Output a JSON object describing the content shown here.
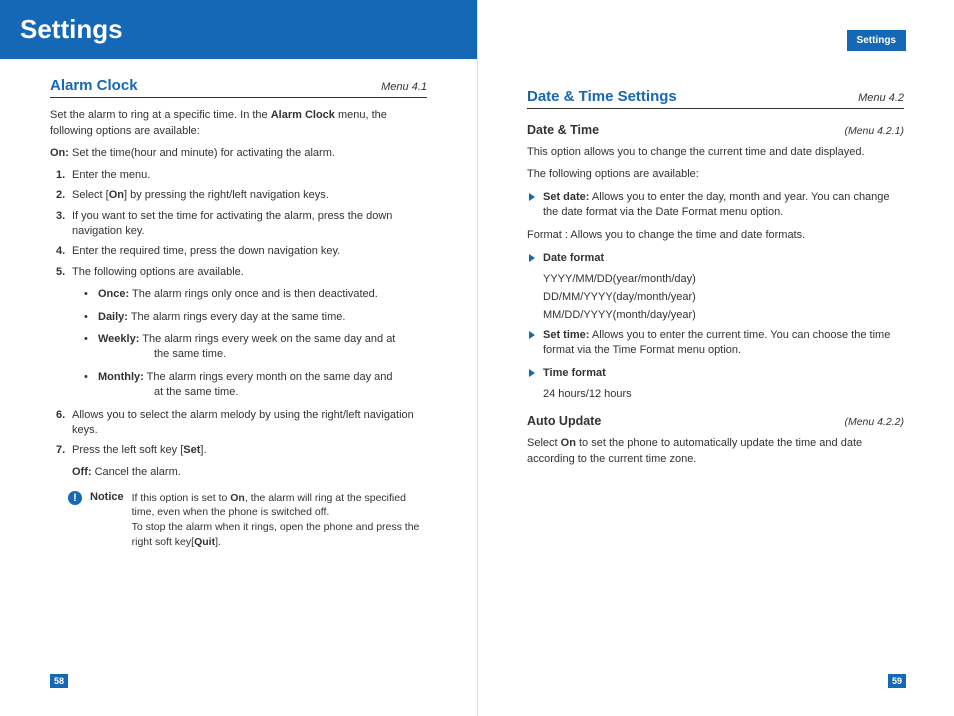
{
  "banner_title": "Settings",
  "header_tab": "Settings",
  "page_left_num": "58",
  "page_right_num": "59",
  "left": {
    "section_title": "Alarm Clock",
    "section_menu": "Menu 4.1",
    "intro_pre": "Set the alarm to ring at a specific time. In the ",
    "intro_bold": "Alarm Clock",
    "intro_post": " menu, the following options are available:",
    "on_label": "On:",
    "on_text": " Set the time(hour and minute) for activating the alarm.",
    "steps": {
      "s1": "Enter the menu.",
      "s2_pre": "Select [",
      "s2_bold": "On",
      "s2_post": "] by pressing the right/left navigation keys.",
      "s3": "If you want to set the time for activating the alarm, press the down navigation key.",
      "s4": "Enter the required time, press the down navigation key.",
      "s5": "The following options are available.",
      "once_l": "Once:",
      "once_t": " The alarm rings only once and is then deactivated.",
      "daily_l": "Daily:",
      "daily_t": " The alarm rings every day at the same time.",
      "weekly_l": "Weekly:",
      "weekly_t": " The alarm rings every week on the same day and at",
      "weekly_c": "the same time.",
      "monthly_l": "Monthly:",
      "monthly_t": " The alarm rings every month on the same day and",
      "monthly_c": "at the same time.",
      "s6": "Allows you to select the alarm melody by using the right/left navigation keys.",
      "s7_pre": "Press the left soft key [",
      "s7_bold": "Set",
      "s7_post": "]."
    },
    "off_label": "Off:",
    "off_text": " Cancel the alarm.",
    "notice_label": "Notice",
    "notice_a_pre": "If this option is set to ",
    "notice_a_bold": "On",
    "notice_a_post": ", the alarm will ring at the specified time, even when the phone is switched off.",
    "notice_b_pre": "To stop the alarm when it rings, open the phone and press the right soft key[",
    "notice_b_bold": "Quit",
    "notice_b_post": "]."
  },
  "right": {
    "section_title": "Date & Time Settings",
    "section_menu": "Menu 4.2",
    "dt_title": "Date & Time",
    "dt_menu": "(Menu 4.2.1)",
    "dt_intro": "This option allows you to change the current time and date displayed.",
    "dt_following": "The following options are available:",
    "setdate_l": "Set date:",
    "setdate_t": " Allows you to enter the day, month and year. You can change the date format via the Date Format menu option.",
    "format_line": "Format : Allows you to change the time and date formats.",
    "dateformat_l": "Date format",
    "df1": "YYYY/MM/DD(year/month/day)",
    "df2": "DD/MM/YYYY(day/month/year)",
    "df3": "MM/DD/YYYY(month/day/year)",
    "settime_l": "Set time:",
    "settime_t": " Allows you to enter the current time. You can choose the time format via the Time Format menu option.",
    "timeformat_l": "Time format",
    "tf1": "24 hours/12 hours",
    "au_title": "Auto Update",
    "au_menu": "(Menu 4.2.2)",
    "au_pre": "Select ",
    "au_bold": "On",
    "au_post": " to set the phone to automatically update the time and date according to the current time zone."
  }
}
